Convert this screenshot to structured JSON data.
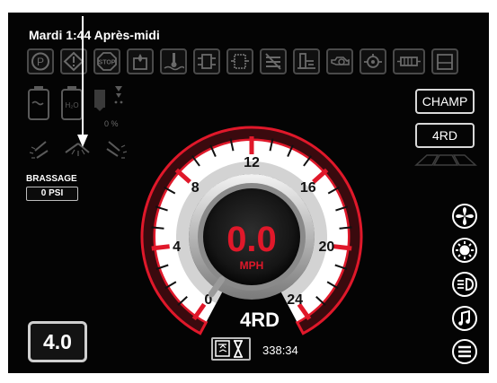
{
  "status_bar": {
    "datetime": "Mardi 1:44 Après-midi",
    "indicators": [
      "parking-brake-icon",
      "warning-diamond-icon",
      "stop-icon",
      "fuel-water-icon",
      "coolant-temp-icon",
      "transmission-icon",
      "filter-icon",
      "regen-inhibit-icon",
      "hydraulic-oil-icon",
      "engine-oil-icon",
      "engine-alert-icon",
      "fuel-filter-icon",
      "fuel-tank-icon"
    ]
  },
  "tank_panel": {
    "tank_icons": [
      "rinse-tank-icon",
      "clean-water-tank-icon"
    ],
    "tank_percent": "0 %",
    "agitation_label": "BRASSAGE",
    "agitation_value": "0 PSI",
    "boom_icons": [
      "left-boom-spray-icon",
      "center-boom-spray-icon",
      "right-boom-spray-icon"
    ]
  },
  "speedometer": {
    "speed": "0.0",
    "unit": "MPH",
    "scale_labels": [
      "0",
      "4",
      "8",
      "12",
      "16",
      "20",
      "24"
    ],
    "drive_mode": "4RD",
    "timer_icon": "spray-timer-icon",
    "engine_hours": "338:34"
  },
  "right_panel": {
    "field_button": "CHAMP",
    "steering_button": "4RD",
    "shortcuts": [
      "fan-icon",
      "light-icon",
      "headlight-icon",
      "music-icon",
      "menu-icon"
    ]
  },
  "rate_display": "4.0",
  "colors": {
    "accent": "#e0182a",
    "background": "#040404",
    "text": "#ffffff"
  }
}
